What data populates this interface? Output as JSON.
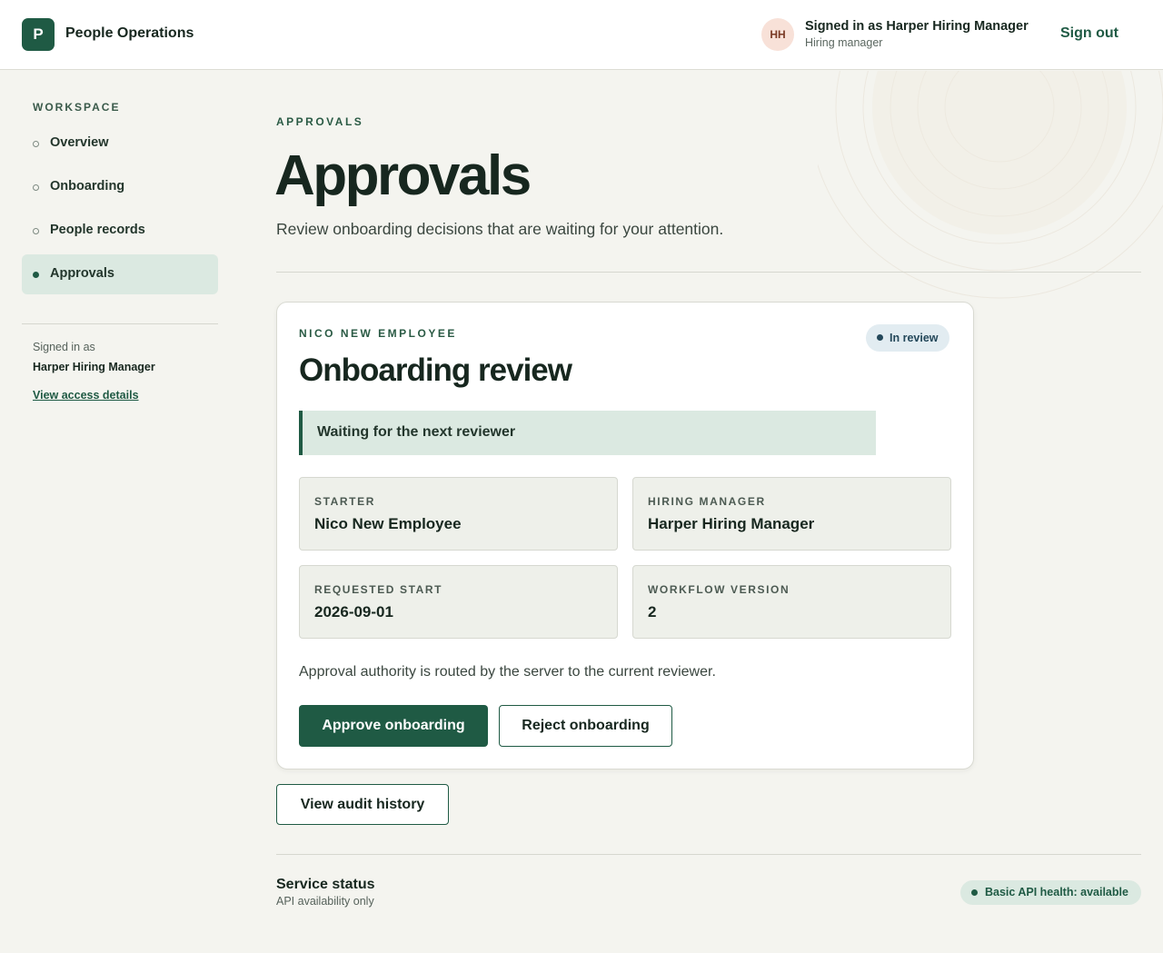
{
  "header": {
    "logo_letter": "P",
    "app_name": "People Operations",
    "avatar_initials": "HH",
    "signed_in_line": "Signed in as Harper Hiring Manager",
    "role": "Hiring manager",
    "sign_out": "Sign out"
  },
  "sidebar": {
    "heading": "WORKSPACE",
    "items": [
      {
        "label": "Overview",
        "active": false
      },
      {
        "label": "Onboarding",
        "active": false
      },
      {
        "label": "People records",
        "active": false
      },
      {
        "label": "Approvals",
        "active": true
      }
    ],
    "signed_in_label": "Signed in as",
    "user_name": "Harper Hiring Manager",
    "access_link": "View access details"
  },
  "main": {
    "eyebrow": "APPROVALS",
    "title": "Approvals",
    "subtitle": "Review onboarding decisions that are waiting for your attention."
  },
  "card": {
    "eyebrow": "NICO NEW EMPLOYEE",
    "badge": "In review",
    "title": "Onboarding review",
    "notice": "Waiting for the next reviewer",
    "fields": [
      {
        "label": "STARTER",
        "value": "Nico New Employee"
      },
      {
        "label": "HIRING MANAGER",
        "value": "Harper Hiring Manager"
      },
      {
        "label": "REQUESTED START",
        "value": "2026-09-01"
      },
      {
        "label": "WORKFLOW VERSION",
        "value": "2"
      }
    ],
    "note": "Approval authority is routed by the server to the current reviewer.",
    "approve": "Approve onboarding",
    "reject": "Reject onboarding"
  },
  "audit_button": "View audit history",
  "status": {
    "title": "Service status",
    "subtitle": "API availability only",
    "health": "Basic API health: available"
  },
  "colors": {
    "brand": "#1f5a44",
    "active_nav": "#dbe9e1",
    "badge_bg": "#e2ecf1",
    "page_bg": "#f4f4ef"
  },
  "icons": [
    "status-dot-icon"
  ]
}
